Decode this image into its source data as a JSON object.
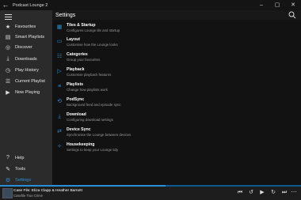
{
  "window": {
    "title": "Podcast Lounge 2",
    "back_icon": "back-arrow-icon",
    "minimize": "–",
    "maximize": "▢",
    "close": "✕"
  },
  "sidebar": {
    "items": [
      {
        "label": "Favourites",
        "icon": "star-icon",
        "glyph": "★"
      },
      {
        "label": "Smart Playlists",
        "icon": "playlist-icon",
        "glyph": "▤"
      },
      {
        "label": "Discover",
        "icon": "globe-icon",
        "glyph": "◎"
      },
      {
        "label": "Downloads",
        "icon": "download-icon",
        "glyph": "⤓"
      },
      {
        "label": "Play History",
        "icon": "history-icon",
        "glyph": "◷"
      },
      {
        "label": "Current Playlist",
        "icon": "list-icon",
        "glyph": "☰"
      },
      {
        "label": "Now Playing",
        "icon": "play-icon",
        "glyph": "▶"
      }
    ],
    "bottom_items": [
      {
        "label": "Help",
        "icon": "help-icon",
        "glyph": "?"
      },
      {
        "label": "Tools",
        "icon": "wrench-icon",
        "glyph": "✎"
      },
      {
        "label": "Settings",
        "icon": "gear-icon",
        "glyph": "⚙"
      }
    ]
  },
  "main": {
    "title": "Settings",
    "settings": [
      {
        "title": "Tiles & Startup",
        "desc": "Configures Lounge tile and startup",
        "icon": "tiles-icon",
        "glyph": "▦"
      },
      {
        "title": "Layout",
        "desc": "Customise how the Lounge looks",
        "icon": "layout-icon",
        "glyph": "▭"
      },
      {
        "title": "Categories",
        "desc": "Group your favourites",
        "icon": "categories-icon",
        "glyph": "☷"
      },
      {
        "title": "Playback",
        "desc": "Customise playback features",
        "icon": "playback-icon",
        "glyph": "▷"
      },
      {
        "title": "Playlists",
        "desc": "Change how playlists work",
        "icon": "playlists-icon",
        "glyph": "≡"
      },
      {
        "title": "PodSync",
        "desc": "Background feed and episode sync",
        "icon": "sync-icon",
        "glyph": "⟲"
      },
      {
        "title": "Download",
        "desc": "Configuring download settings",
        "icon": "download-icon",
        "glyph": "⤓"
      },
      {
        "title": "Device Sync",
        "desc": "Synchronise the Lounge between devices",
        "icon": "device-sync-icon",
        "glyph": "⇄"
      },
      {
        "title": "Housekeeping",
        "desc": "Settings to keep your Lounge tidy",
        "icon": "housekeeping-icon",
        "glyph": "✧"
      }
    ]
  },
  "player": {
    "episode": "Case File: Eliza Clapp & Heather Barnett",
    "podcast": "Casefile True Crime",
    "progress": 0.55,
    "controls": [
      {
        "name": "skip-back-icon",
        "glyph": "⏮"
      },
      {
        "name": "rewind-icon",
        "glyph": "↺"
      },
      {
        "name": "play-icon",
        "glyph": "▶"
      },
      {
        "name": "forward-icon",
        "glyph": "↻"
      },
      {
        "name": "skip-forward-icon",
        "glyph": "⏭"
      },
      {
        "name": "volume-icon",
        "glyph": "🔊"
      },
      {
        "name": "more-icon",
        "glyph": "⋯"
      }
    ]
  },
  "colors": {
    "accent": "#2b8fd6",
    "sidebar": "#2b2b2b",
    "background": "#121212"
  }
}
